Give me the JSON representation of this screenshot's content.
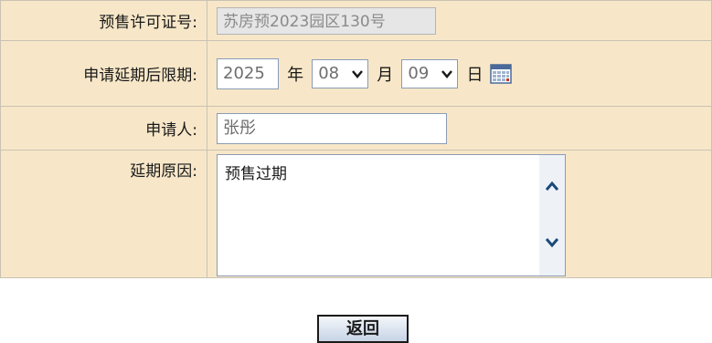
{
  "form": {
    "presale_permit_label": "预售许可证号:",
    "presale_permit_value": "苏房预2023园区130号",
    "deadline_label": "申请延期后限期:",
    "deadline_year": "2025",
    "deadline_year_unit": "年",
    "deadline_month": "08",
    "deadline_month_unit": "月",
    "deadline_day": "09",
    "deadline_day_unit": "日",
    "applicant_label": "申请人:",
    "applicant_value": "张彤",
    "reason_label": "延期原因:",
    "reason_value": "预售过期"
  },
  "actions": {
    "back_label": "返回"
  },
  "icons": {
    "calendar": "calendar-icon",
    "dropdown": "chevron-down-icon",
    "scroll_up": "chevron-up-icon",
    "scroll_down": "chevron-down-icon"
  },
  "colors": {
    "row_background": "#f7e7c8",
    "border": "#c9c2b4",
    "input_border": "#8a9bb5",
    "chevron": "#1a4a7a"
  }
}
